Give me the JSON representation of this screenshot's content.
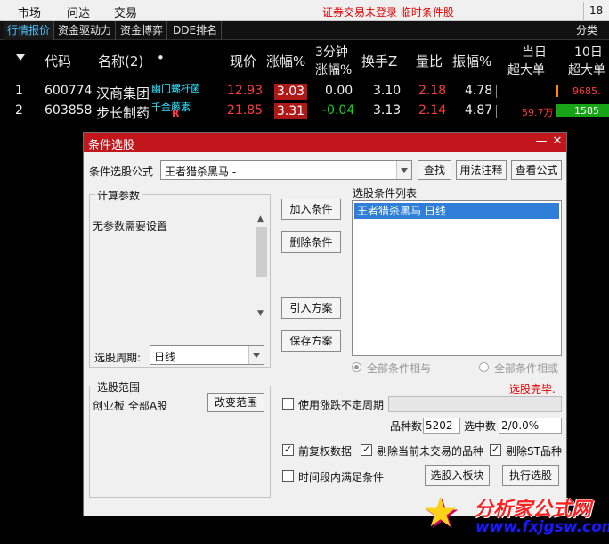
{
  "menu": {
    "items": [
      "市场",
      "问达",
      "交易"
    ],
    "status": "证券交易未登录  临时条件股",
    "corner": "18"
  },
  "tabs": [
    "行情报价",
    "资金驱动力",
    "资金博弈",
    "DDE排名"
  ],
  "tab_right": "分类过",
  "table": {
    "headers": {
      "code": "代码",
      "name": "名称(2)",
      "dot": "•",
      "price": "现价",
      "change": "涨幅%",
      "min3_line1": "3分钟",
      "min3_line2": "涨幅%",
      "turnover": "换手Z",
      "volratio": "量比",
      "amplitude": "振幅%",
      "big_line1": "当日",
      "big_line2": "超大单",
      "ten_line1": "10日",
      "ten_line2": "超大单"
    },
    "rows": [
      {
        "idx": "1",
        "code": "600774",
        "name": "汉商集团",
        "tag1": "幽门螺杆菌",
        "tag2": "",
        "price": "12.93",
        "change": "3.03",
        "min3": "0.00",
        "turnover": "3.10",
        "volratio": "2.18",
        "amplitude": "4.78",
        "big": "",
        "ten": "9685."
      },
      {
        "idx": "2",
        "code": "603858",
        "name": "步长制药",
        "tag1": "千金藤素",
        "tag2": "R",
        "price": "21.85",
        "change": "3.31",
        "min3": "-0.04",
        "turnover": "3.13",
        "volratio": "2.14",
        "amplitude": "4.87",
        "big": "59.7万",
        "ten": "1585"
      }
    ]
  },
  "dialog": {
    "title": "条件选股",
    "formula_label": "条件选股公式",
    "formula_value": "王者猎杀黑马 -",
    "btn_find": "查找",
    "btn_usage": "用法注释",
    "btn_view": "查看公式",
    "params_group": "计算参数",
    "params_text": "无参数需要设置",
    "period_label": "选股周期:",
    "period_value": "日线",
    "btn_add": "加入条件",
    "btn_delete": "删除条件",
    "btn_import": "引入方案",
    "btn_save": "保存方案",
    "list_title": "选股条件列表",
    "list_items": [
      "王者猎杀黑马  日线"
    ],
    "radio_and": "全部条件相与",
    "radio_or": "全部条件相或",
    "done_text": "选股完毕.",
    "range_group": "选股范围",
    "range_text": "创业板 全部A股",
    "btn_change_range": "改变范围",
    "chk_uncertain": "使用涨跌不定周期",
    "count_label": "品种数",
    "count_value": "5202",
    "selected_label": "选中数",
    "selected_value": "2/0.0%",
    "chk_fq": "前复权数据",
    "chk_remove_untraded": "剔除当前未交易的品种",
    "chk_remove_st": "剔除ST品种",
    "chk_time_range": "时间段内满足条件",
    "btn_to_block": "选股入板块",
    "btn_execute": "执行选股"
  },
  "watermark": {
    "line1": "分析家公式网",
    "line2": "www.fxjgsw.com"
  },
  "colors": {
    "title_bar": "#c0161c",
    "up": "#ff3b3b",
    "down": "#19d219",
    "selection": "#2f7fd8"
  }
}
